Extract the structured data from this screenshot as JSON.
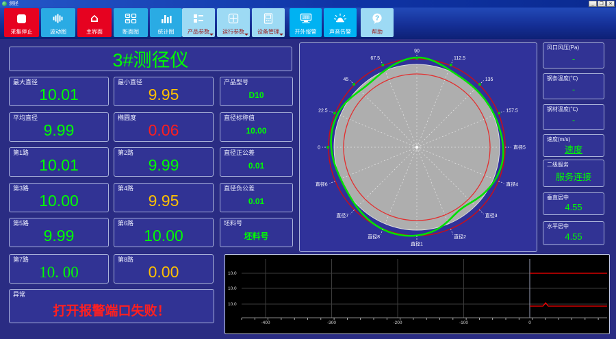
{
  "window": {
    "title": "测径",
    "minimize_label": "_",
    "maximize_label": "❐",
    "close_label": "✕"
  },
  "toolbar": {
    "buttons": [
      {
        "label": "采集停止",
        "style": "red",
        "icon": "stop-icon",
        "dropdown": false
      },
      {
        "label": "波动图",
        "style": "blue",
        "icon": "waveform-icon",
        "dropdown": false
      },
      {
        "label": "主界面",
        "style": "red",
        "icon": "home-icon",
        "dropdown": false
      },
      {
        "label": "断面图",
        "style": "blue",
        "icon": "panels-icon",
        "dropdown": false
      },
      {
        "label": "统计图",
        "style": "blue",
        "icon": "bar-chart-icon",
        "dropdown": false
      },
      {
        "label": "产品参数",
        "style": "pale",
        "icon": "product-params-icon",
        "dropdown": true
      },
      {
        "label": "运行参数",
        "style": "pale",
        "icon": "run-params-icon",
        "dropdown": true
      },
      {
        "label": "设备管理",
        "style": "pale",
        "icon": "device-icon",
        "dropdown": true
      },
      {
        "label": "开外报警",
        "style": "cyan",
        "icon": "monitor-icon",
        "dropdown": false
      },
      {
        "label": "声音告警",
        "style": "cyan",
        "icon": "siren-icon",
        "dropdown": false
      },
      {
        "label": "帮助",
        "style": "pale",
        "icon": "help-icon",
        "dropdown": false
      }
    ]
  },
  "left": {
    "title": "3#测径仪",
    "cells": [
      {
        "label": "最大直径",
        "value": "10.01",
        "color": "green",
        "size": "big",
        "col": 0,
        "row": 0
      },
      {
        "label": "最小直径",
        "value": "9.95",
        "color": "yellow",
        "size": "big",
        "col": 1,
        "row": 0
      },
      {
        "label": "产品型号",
        "value": "D10",
        "color": "green",
        "size": "small",
        "col": 2,
        "row": 0
      },
      {
        "label": "平均直径",
        "value": "9.99",
        "color": "green",
        "size": "big",
        "col": 0,
        "row": 1
      },
      {
        "label": "椭圆度",
        "value": "0.06",
        "color": "red",
        "size": "big",
        "col": 1,
        "row": 1
      },
      {
        "label": "直径标称值",
        "value": "10.00",
        "color": "green",
        "size": "small",
        "col": 2,
        "row": 1
      },
      {
        "label": "第1路",
        "value": "10.01",
        "color": "green",
        "size": "big",
        "col": 0,
        "row": 2
      },
      {
        "label": "第2路",
        "value": "9.99",
        "color": "green",
        "size": "big",
        "col": 1,
        "row": 2
      },
      {
        "label": "直径正公差",
        "value": "0.01",
        "color": "green",
        "size": "small",
        "col": 2,
        "row": 2
      },
      {
        "label": "第3路",
        "value": "10.00",
        "color": "green",
        "size": "big",
        "col": 0,
        "row": 3
      },
      {
        "label": "第4路",
        "value": "9.95",
        "color": "yellow",
        "size": "big",
        "col": 1,
        "row": 3
      },
      {
        "label": "直径负公差",
        "value": "0.01",
        "color": "green",
        "size": "small",
        "col": 2,
        "row": 3
      },
      {
        "label": "第5路",
        "value": "9.99",
        "color": "green",
        "size": "big",
        "col": 0,
        "row": 4
      },
      {
        "label": "第6路",
        "value": "10.00",
        "color": "green",
        "size": "big",
        "col": 1,
        "row": 4
      },
      {
        "label": "坯料号",
        "value": "坯料号",
        "color": "green",
        "size": "small",
        "col": 2,
        "row": 4
      },
      {
        "label": "第7路",
        "value": "10. 00",
        "color": "green",
        "size": "big",
        "serif": true,
        "col": 0,
        "row": 5
      },
      {
        "label": "第8路",
        "value": "0.00",
        "color": "yellow",
        "size": "big",
        "col": 1,
        "row": 5
      }
    ],
    "alarm": {
      "label": "异常",
      "message": "打开报警端口失败！"
    }
  },
  "right_panels": [
    {
      "label": "风口风压(Pa)",
      "value": "-",
      "underline": false
    },
    {
      "label": "钢条温度(℃)",
      "value": "-",
      "underline": false
    },
    {
      "label": "钢材温度(℃)",
      "value": "-",
      "underline": false
    },
    {
      "label": "速度(m/s)",
      "value": "速度",
      "underline": true
    },
    {
      "label": "二级服务",
      "value": "服务连接",
      "underline": false
    },
    {
      "label": "垂直居中",
      "value": "4.55",
      "underline": false
    },
    {
      "label": "水平居中",
      "value": "4.55",
      "underline": false
    }
  ],
  "status_colors": {
    "ok": "#00ff00",
    "warning": "#ffc000",
    "alarm": "#ff1e1e"
  },
  "chart_data": [
    {
      "type": "line",
      "name": "cross-section-profile",
      "coordinate": "polar",
      "angle_tick_labels": [
        "0",
        "22.5",
        "45",
        "67.5",
        "90",
        "112.5",
        "135",
        "157.5"
      ],
      "diameter_ray_labels": [
        "直径1",
        "直径2",
        "直径3",
        "直径4",
        "直径5",
        "直径6",
        "直径7",
        "直径8"
      ],
      "nominal_diameter": 10.0,
      "tolerance_upper": 10.01,
      "tolerance_lower": 9.99,
      "measured_diameters": [
        10.01,
        9.99,
        10.0,
        9.95,
        9.99,
        10.0,
        10.0,
        0.0
      ],
      "grid": "dashed-radial-16",
      "profile_color": "#00e100",
      "tolerance_color": "#c01020",
      "nominal_fill": "#aeaeae"
    },
    {
      "type": "line",
      "name": "diameter-trend",
      "x": {
        "ticks": [
          -400,
          -300,
          -200,
          -100,
          0
        ],
        "range": [
          -436,
          117
        ]
      },
      "y_tick_labels": [
        "10.0",
        "10.0",
        "10.0"
      ],
      "series": [
        {
          "name": "upper-trace",
          "color": "#ff0000",
          "points": [
            [
              0,
              10.0
            ],
            [
              117,
              10.0
            ]
          ]
        },
        {
          "name": "lower-trace",
          "color": "#ff0000",
          "points": [
            [
              0,
              9.95
            ],
            [
              20,
              9.95
            ],
            [
              24,
              9.955
            ],
            [
              28,
              9.95
            ],
            [
              117,
              9.95
            ]
          ]
        }
      ],
      "background": "#000000",
      "grid": true,
      "legend_position": "none"
    }
  ]
}
